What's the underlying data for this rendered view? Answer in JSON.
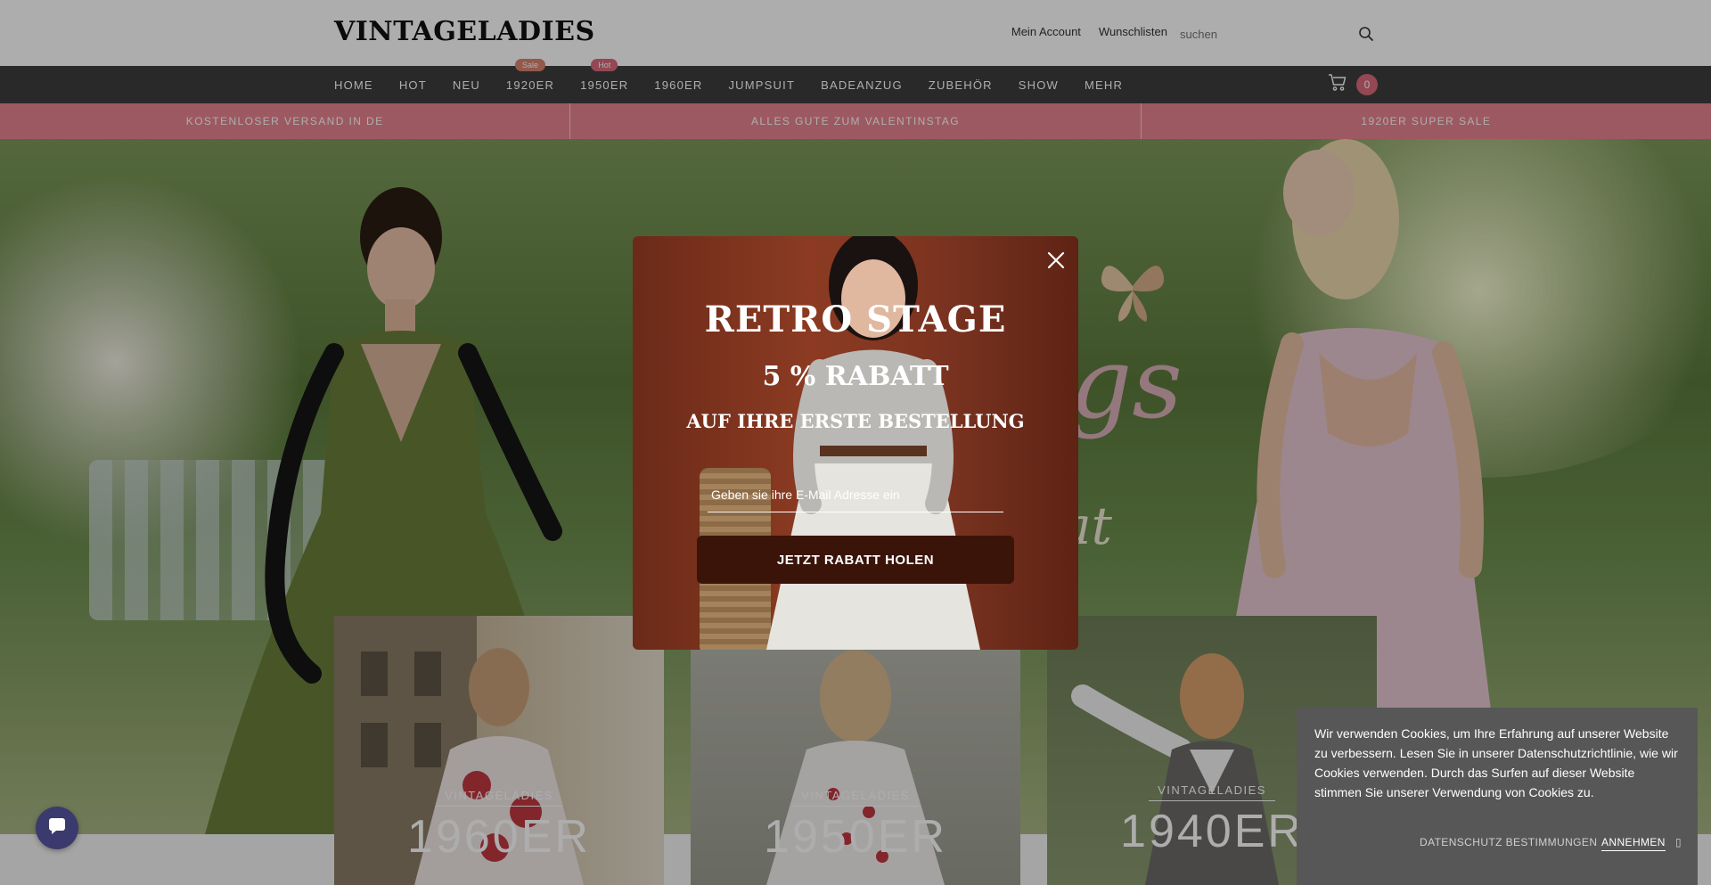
{
  "header": {
    "logo": "VINTAGELADIES",
    "account_link": "Mein Account",
    "wishlist_link": "Wunschlisten",
    "search_placeholder": "suchen"
  },
  "nav": {
    "items": [
      {
        "label": "HOME"
      },
      {
        "label": "HOT"
      },
      {
        "label": "NEU"
      },
      {
        "label": "1920ER",
        "badge": "Sale",
        "badge_color": "#d9846f"
      },
      {
        "label": "1950ER",
        "badge": "Hot",
        "badge_color": "#d96a7d"
      },
      {
        "label": "1960ER"
      },
      {
        "label": "JUMPSUIT"
      },
      {
        "label": "BADEANZUG"
      },
      {
        "label": "ZUBEHÖR"
      },
      {
        "label": "SHOW"
      },
      {
        "label": "MEHR"
      }
    ],
    "cart_count": "0"
  },
  "promo": {
    "items": [
      "KOSTENLOSER VERSAND IN DE",
      "ALLES GUTE ZUM VALENTINSTAG",
      "1920ER SUPER SALE"
    ]
  },
  "cards": [
    {
      "brand": "VINTAGELADIES",
      "era": "1960ER"
    },
    {
      "brand": "VINTAGELADIES",
      "era": "1950ER"
    },
    {
      "brand": "VINTAGELADIES",
      "era": "1940ER"
    }
  ],
  "modal": {
    "title": "RETRO STAGE",
    "discount": "5 % RABATT",
    "subtitle": "AUF IHRE ERSTE BESTELLUNG",
    "email_placeholder": "Geben sie ihre E-Mail Adresse ein",
    "cta": "JETZT RABATT HOLEN"
  },
  "cookie": {
    "text": "Wir verwenden Cookies, um Ihre Erfahrung auf unserer Website zu verbessern. Lesen Sie in unserer Datenschutzrichtlinie, wie wir Cookies verwenden. Durch das Surfen auf dieser Website stimmen Sie unserer Verwendung von Cookies zu.",
    "privacy": "DATENSCHUTZ BESTIMMUNGEN",
    "accept": "ANNEHMEN"
  },
  "colors": {
    "nav_bg": "#3d3d3d",
    "promo_bg": "#e7838f",
    "cart_badge": "#d96a7d",
    "modal_button": "#3a1408",
    "cookie_bg": "#575757"
  }
}
